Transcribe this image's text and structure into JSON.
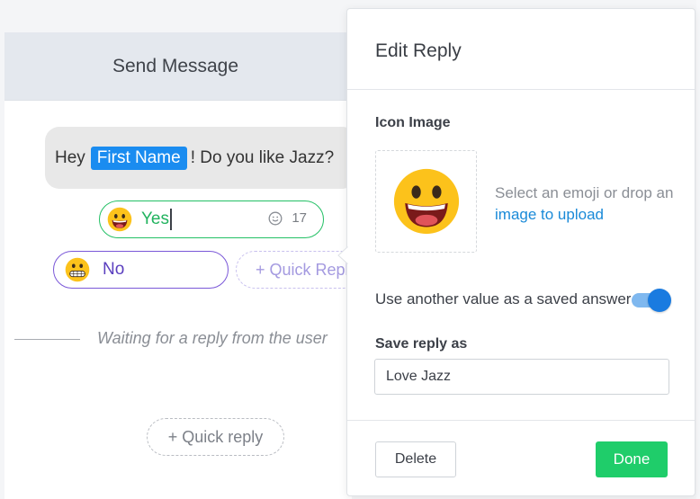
{
  "card": {
    "title": "Send Message",
    "message": {
      "before": "Hey",
      "tag": "First Name",
      "after": "! Do you like Jazz?"
    },
    "replies": [
      {
        "label": "Yes",
        "emoji": "grinning-face",
        "char_count": "17",
        "border_color": "#23c065"
      },
      {
        "label": "No",
        "emoji": "grimacing-face",
        "border_color": "#7a57d8"
      }
    ],
    "quick_reply_label": "+ Quick Reply",
    "waiting_text": "Waiting for a reply from the user",
    "bottom_quick_reply_label": "+ Quick reply"
  },
  "panel": {
    "title": "Edit Reply",
    "icon_image_label": "Icon Image",
    "icon_emoji": "grinning-face",
    "hint_text": "Select an emoji or drop an",
    "hint_link": "image to upload",
    "toggle_label": "Use another value as a saved answer",
    "toggle_on": true,
    "save_reply_label": "Save reply as",
    "save_reply_value": "Love Jazz",
    "delete_label": "Delete",
    "done_label": "Done"
  },
  "colors": {
    "accent_blue": "#1a8cf0",
    "success_green": "#1fcd6a",
    "purple": "#7a57d8"
  }
}
